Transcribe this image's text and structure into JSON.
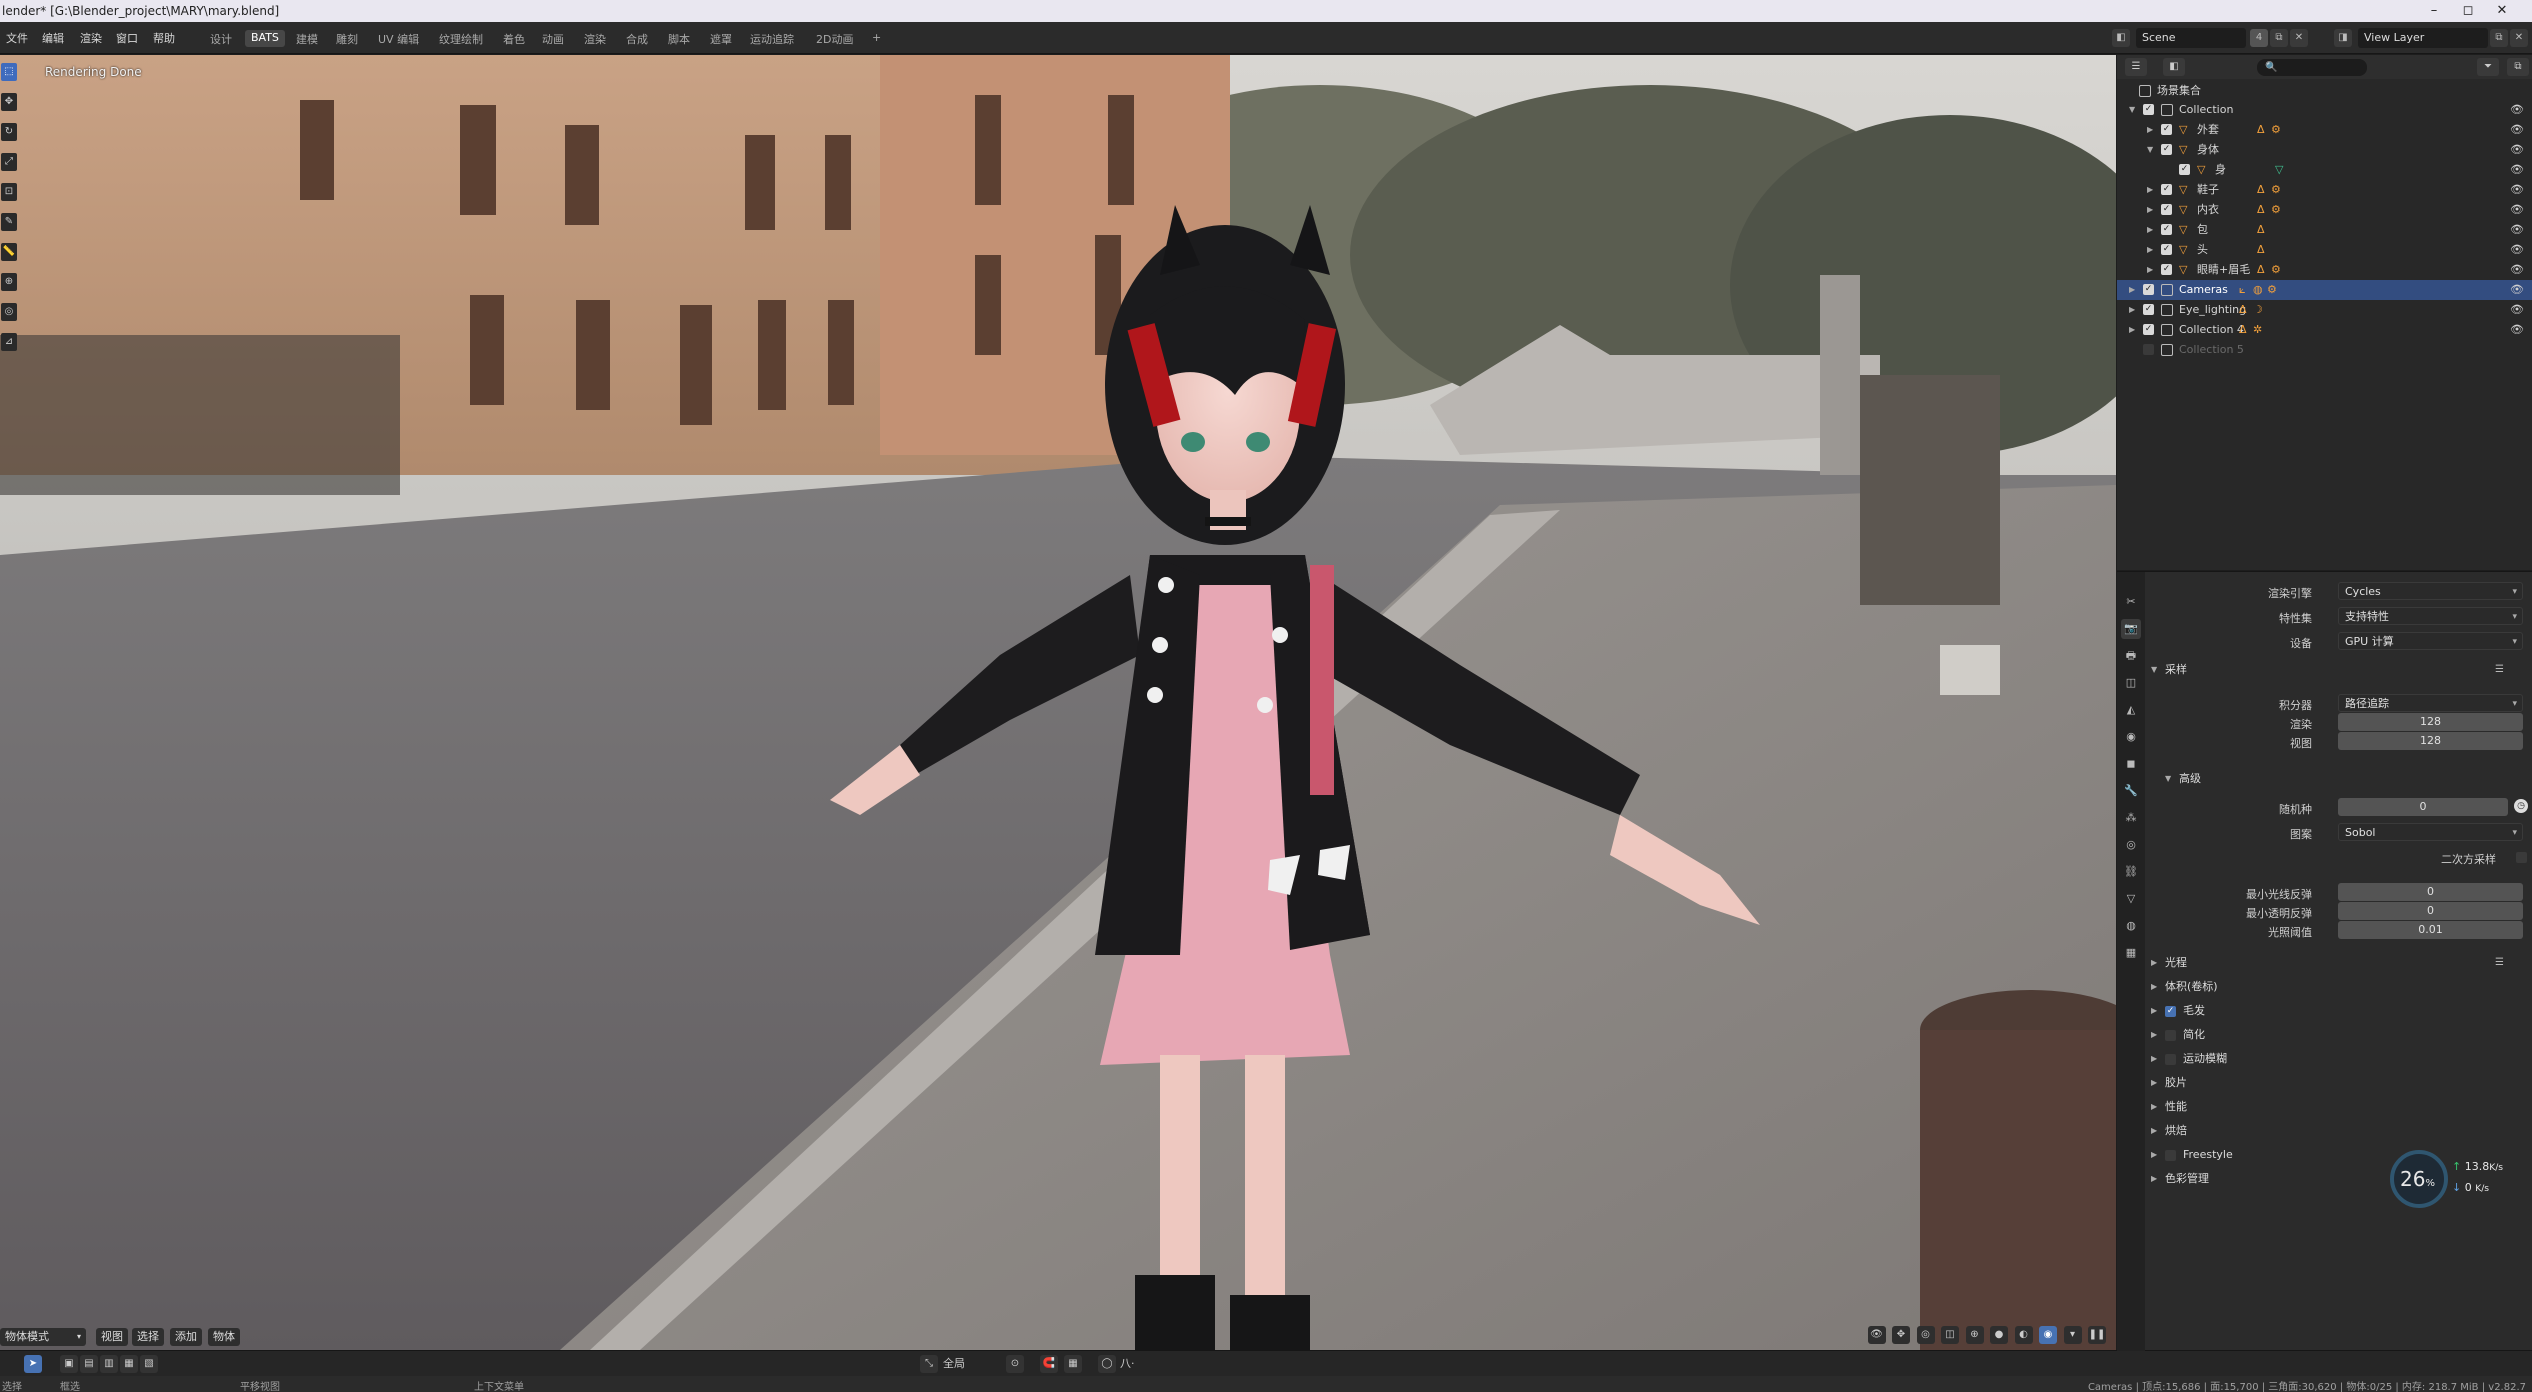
{
  "window": {
    "title": "lender* [G:\\Blender_project\\MARY\\mary.blend]",
    "minimize": "–",
    "maximize": "◻",
    "close": "✕"
  },
  "menu": [
    "文件",
    "编辑",
    "渲染",
    "窗口",
    "帮助"
  ],
  "workspaces": [
    {
      "label": "设计",
      "active": false
    },
    {
      "label": "BATS",
      "active": true
    },
    {
      "label": "建模",
      "active": false
    },
    {
      "label": "雕刻",
      "active": false
    },
    {
      "label": "UV 编辑",
      "active": false
    },
    {
      "label": "纹理绘制",
      "active": false
    },
    {
      "label": "着色",
      "active": false
    },
    {
      "label": "动画",
      "active": false
    },
    {
      "label": "渲染",
      "active": false
    },
    {
      "label": "合成",
      "active": false
    },
    {
      "label": "脚本",
      "active": false
    },
    {
      "label": "遮罩",
      "active": false
    },
    {
      "label": "运动追踪",
      "active": false
    },
    {
      "label": "2D动画",
      "active": false
    }
  ],
  "add_workspace": "+",
  "scene": {
    "name": "Scene",
    "count": "4"
  },
  "view_layer": {
    "name": "View Layer"
  },
  "viewport": {
    "status": "Rendering Done",
    "mode": "物体模式",
    "header_menus": [
      "视图",
      "选择",
      "添加",
      "物体"
    ]
  },
  "left_tools": [
    "⬚",
    "✥",
    "↻",
    "⤢",
    "⊡",
    "✎",
    "📏",
    "⊕",
    "◎",
    "⊿"
  ],
  "timeline": {
    "pivot": "全局",
    "snap": "八·"
  },
  "statusbar": {
    "left_items": [
      "选择",
      "框选",
      "平移视图",
      "上下文菜单"
    ],
    "stats": "Cameras | 顶点:15,686 | 面:15,700 | 三角面:30,620 | 物体:0/25 | 内存: 218.7 MiB | v2.82.7"
  },
  "outliner": {
    "search_placeholder": "",
    "root": "场景集合",
    "rows": [
      {
        "label": "Collection",
        "indent": 1,
        "arrow": "▼",
        "type": "collection",
        "selected": false,
        "disabled": false
      },
      {
        "label": "外套",
        "indent": 2,
        "arrow": "▶",
        "type": "object",
        "selected": false,
        "disabled": false
      },
      {
        "label": "身体",
        "indent": 2,
        "arrow": "▼",
        "type": "object",
        "selected": false,
        "disabled": false
      },
      {
        "label": "身",
        "indent": 3,
        "arrow": "",
        "type": "mesh",
        "selected": false,
        "disabled": false
      },
      {
        "label": "鞋子",
        "indent": 2,
        "arrow": "▶",
        "type": "object",
        "selected": false,
        "disabled": false
      },
      {
        "label": "内衣",
        "indent": 2,
        "arrow": "▶",
        "type": "object",
        "selected": false,
        "disabled": false
      },
      {
        "label": "包",
        "indent": 2,
        "arrow": "▶",
        "type": "object",
        "selected": false,
        "disabled": false
      },
      {
        "label": "头",
        "indent": 2,
        "arrow": "▶",
        "type": "object",
        "selected": false,
        "disabled": false
      },
      {
        "label": "眼睛+眉毛",
        "indent": 2,
        "arrow": "▶",
        "type": "object",
        "selected": false,
        "disabled": false
      },
      {
        "label": "Cameras",
        "indent": 1,
        "arrow": "▶",
        "type": "collection",
        "selected": true,
        "disabled": false
      },
      {
        "label": "Eye_lighting",
        "indent": 1,
        "arrow": "▶",
        "type": "collection",
        "selected": false,
        "disabled": false
      },
      {
        "label": "Collection 4",
        "indent": 1,
        "arrow": "▶",
        "type": "collection",
        "selected": false,
        "disabled": false
      },
      {
        "label": "Collection 5",
        "indent": 1,
        "arrow": "",
        "type": "collection",
        "selected": false,
        "disabled": true
      }
    ]
  },
  "properties": {
    "render_engine_label": "渲染引擎",
    "render_engine": "Cycles",
    "feature_set_label": "特性集",
    "feature_set": "支持特性",
    "device_label": "设备",
    "device": "GPU 计算",
    "sampling": {
      "title": "采样",
      "integrator_label": "积分器",
      "integrator": "路径追踪",
      "render_label": "渲染",
      "render": "128",
      "viewport_label": "视图",
      "viewport": "128",
      "advanced": {
        "title": "高级",
        "seed_label": "随机种",
        "seed": "0",
        "pattern_label": "图案",
        "pattern": "Sobol",
        "square_samples_label": "二次方采样",
        "min_light_bounces_label": "最小光线反弹",
        "min_light_bounces": "0",
        "min_transparent_bounces_label": "最小透明反弹",
        "min_transparent_bounces": "0",
        "light_threshold_label": "光照阈值",
        "light_threshold": "0.01"
      }
    },
    "sections": [
      {
        "label": "光程",
        "checkbox": null,
        "list": true
      },
      {
        "label": "体积(卷标)",
        "checkbox": null,
        "list": false
      },
      {
        "label": "毛发",
        "checkbox": true,
        "list": false
      },
      {
        "label": "简化",
        "checkbox": false,
        "list": false
      },
      {
        "label": "运动模糊",
        "checkbox": false,
        "list": false
      },
      {
        "label": "胶片",
        "checkbox": null,
        "list": false
      },
      {
        "label": "性能",
        "checkbox": null,
        "list": false
      },
      {
        "label": "烘焙",
        "checkbox": null,
        "list": false
      },
      {
        "label": "Freestyle",
        "checkbox": false,
        "list": false
      },
      {
        "label": "色彩管理",
        "checkbox": null,
        "list": false
      }
    ]
  },
  "perf_widget": {
    "percent": "26",
    "percent_unit": "%",
    "upload": "13.8",
    "upload_unit": "K/s",
    "download": "0",
    "download_unit": "K/s"
  }
}
